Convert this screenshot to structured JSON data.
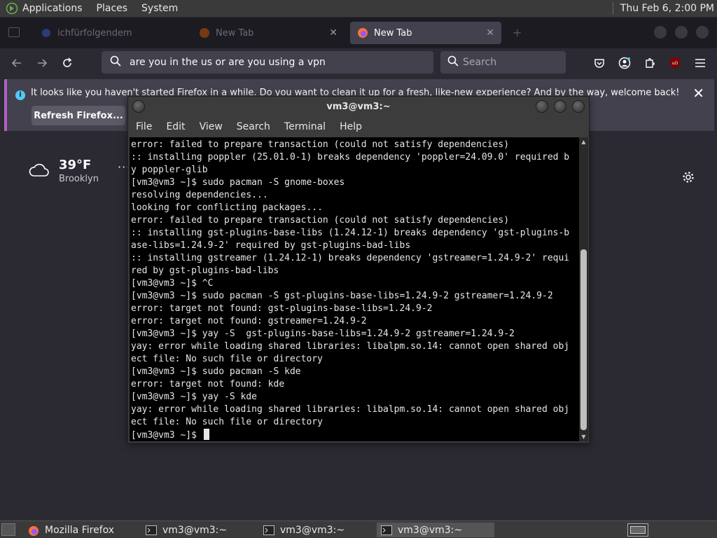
{
  "top_panel": {
    "menus": [
      "Applications",
      "Places",
      "System"
    ],
    "clock": "Thu Feb  6,  2:00 PM"
  },
  "firefox": {
    "tabs": [
      {
        "label": "ichfürfolgendem",
        "active": false
      },
      {
        "label": "New Tab",
        "active": false
      },
      {
        "label": "New Tab",
        "active": true
      }
    ],
    "url_value": "are you in the us or are you using a vpn",
    "search_placeholder": "Search",
    "notification": {
      "message": "It looks like you haven't started Firefox in a while. Do you want to clean it up for a fresh, like-new experience? And by the way, welcome back!",
      "button": "Refresh Firefox..."
    },
    "weather": {
      "temp": "39°F",
      "city": "Brooklyn"
    }
  },
  "terminal": {
    "title": "vm3@vm3:~",
    "menu": [
      "File",
      "Edit",
      "View",
      "Search",
      "Terminal",
      "Help"
    ],
    "lines": [
      "error: failed to prepare transaction (could not satisfy dependencies)",
      ":: installing poppler (25.01.0-1) breaks dependency 'poppler=24.09.0' required b",
      "y poppler-glib",
      "[vm3@vm3 ~]$ sudo pacman -S gnome-boxes",
      "resolving dependencies...",
      "looking for conflicting packages...",
      "error: failed to prepare transaction (could not satisfy dependencies)",
      ":: installing gst-plugins-base-libs (1.24.12-1) breaks dependency 'gst-plugins-b",
      "ase-libs=1.24.9-2' required by gst-plugins-bad-libs",
      ":: installing gstreamer (1.24.12-1) breaks dependency 'gstreamer=1.24.9-2' requi",
      "red by gst-plugins-bad-libs",
      "[vm3@vm3 ~]$ ^C",
      "[vm3@vm3 ~]$ sudo pacman -S gst-plugins-base-libs=1.24.9-2 gstreamer=1.24.9-2",
      "error: target not found: gst-plugins-base-libs=1.24.9-2",
      "error: target not found: gstreamer=1.24.9-2",
      "[vm3@vm3 ~]$ yay -S  gst-plugins-base-libs=1.24.9-2 gstreamer=1.24.9-2",
      "yay: error while loading shared libraries: libalpm.so.14: cannot open shared obj",
      "ect file: No such file or directory",
      "[vm3@vm3 ~]$ sudo pacman -S kde",
      "error: target not found: kde",
      "[vm3@vm3 ~]$ yay -S kde",
      "yay: error while loading shared libraries: libalpm.so.14: cannot open shared obj",
      "ect file: No such file or directory"
    ],
    "prompt": "[vm3@vm3 ~]$ "
  },
  "taskbar": {
    "items": [
      {
        "label": "Mozilla Firefox",
        "active": false
      },
      {
        "label": "vm3@vm3:~",
        "active": false
      },
      {
        "label": "vm3@vm3:~",
        "active": false
      },
      {
        "label": "vm3@vm3:~",
        "active": true
      }
    ]
  }
}
